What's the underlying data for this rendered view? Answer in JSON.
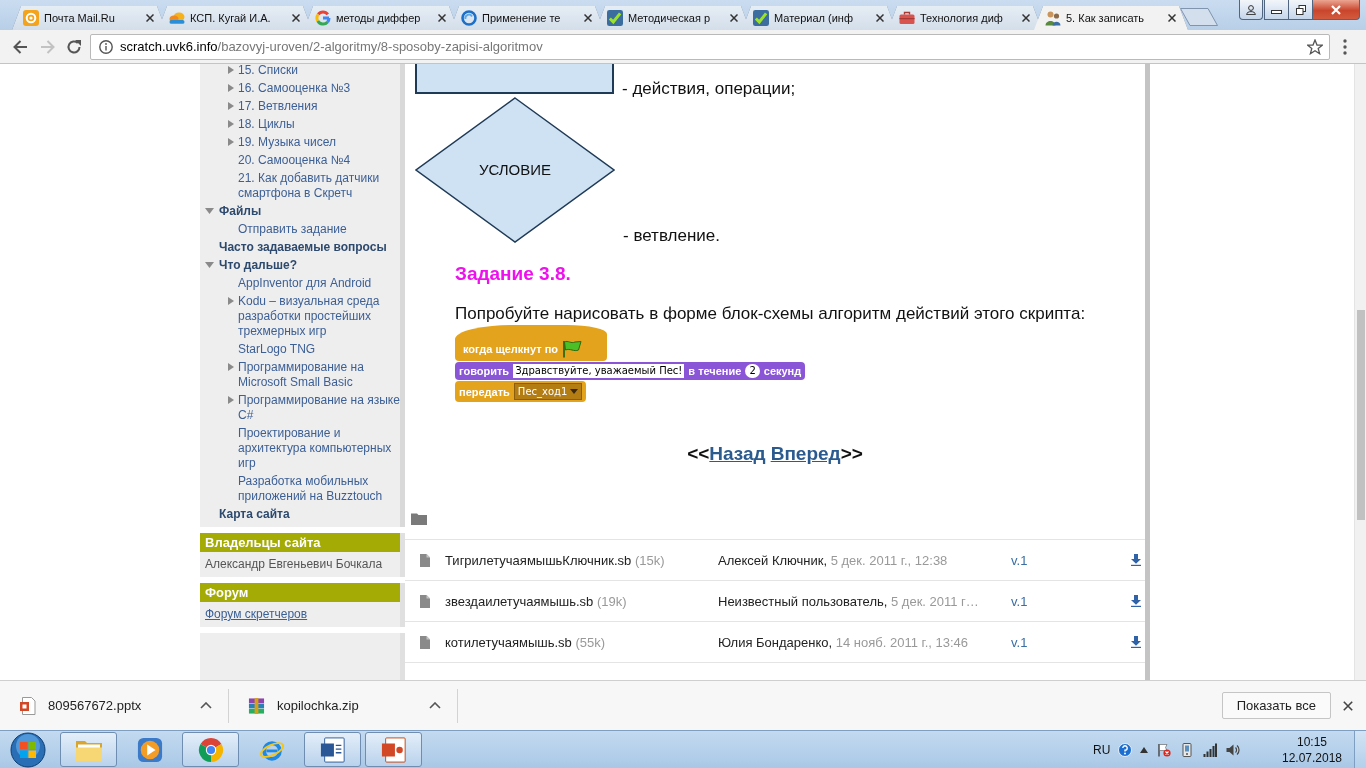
{
  "browser": {
    "tabs": [
      {
        "title": "Почта Mail.Ru",
        "selected": false
      },
      {
        "title": "КСП. Кугай И.А.",
        "selected": false
      },
      {
        "title": "методы диффер",
        "selected": false
      },
      {
        "title": "Применение те",
        "selected": false
      },
      {
        "title": "Методическая р",
        "selected": false
      },
      {
        "title": "Материал (инф",
        "selected": false
      },
      {
        "title": "Технология диф",
        "selected": false
      },
      {
        "title": "5. Как записать",
        "selected": true
      }
    ],
    "can_go_back": true,
    "can_go_forward": false,
    "address": {
      "host": "scratch.uvk6.info",
      "path": "/bazovyj-uroven/2-algoritmy/8-sposoby-zapisi-algoritmov"
    }
  },
  "sidebar": {
    "nav": [
      {
        "children": [
          {
            "label": "15. Списки",
            "expanded": false
          },
          {
            "label": "16. Самооценка №3",
            "expanded": false
          },
          {
            "label": "17. Ветвления",
            "expanded": false
          },
          {
            "label": "18. Циклы",
            "expanded": false
          },
          {
            "label": "19. Музыка чисел",
            "expanded": false
          },
          {
            "label": "20. Самооценка №4"
          },
          {
            "label": "21. Как добавить датчики смартфона в Скретч"
          }
        ]
      },
      {
        "label": "Файлы",
        "expanded": true,
        "children": [
          {
            "label": "Отправить задание"
          }
        ]
      },
      {
        "label": "Часто задаваемые вопросы"
      },
      {
        "label": "Что дальше?",
        "expanded": true,
        "children": [
          {
            "label": "AppInventor для Android"
          },
          {
            "label": "Kodu – визуальная среда разработки простейших трехмерных игр",
            "expanded": false
          },
          {
            "label": "StarLogo TNG"
          },
          {
            "label": "Программирование на Microsoft Small Basic",
            "expanded": false
          },
          {
            "label": "Программирование на языке C#",
            "expanded": false
          },
          {
            "label": "Проектирование и архитектура компьютерных игр"
          },
          {
            "label": "Разработка мобильных приложений на Buzztouch"
          }
        ]
      },
      {
        "label": "Карта сайта"
      }
    ],
    "panels": [
      {
        "title": "Владельцы сайта",
        "kind": "text",
        "text": "Александр Евгеньевич Бочкала"
      },
      {
        "title": "Форум",
        "kind": "link",
        "text": "Форум скретчеров"
      }
    ]
  },
  "content": {
    "legend": [
      {
        "kind": "process",
        "caption": "- действия, операции;"
      },
      {
        "kind": "decision",
        "label": "УСЛОВИЕ",
        "caption": "- ветвление."
      }
    ],
    "task": {
      "title": "Задание 3.8.",
      "text": "Попробуйте нарисовать в форме блок-схемы алгоритм действий этого скрипта:"
    },
    "script": [
      {
        "kind": "hat",
        "color": "#e3a31d",
        "parts": [
          {
            "kind": "text",
            "text": "когда щелкнут по"
          },
          {
            "kind": "flag"
          }
        ]
      },
      {
        "kind": "stack",
        "color": "#8a55d7",
        "parts": [
          {
            "kind": "text",
            "text": "говорить"
          },
          {
            "kind": "input",
            "text": "Здравствуйте, уважаемый Пес!"
          },
          {
            "kind": "text",
            "text": "в течение"
          },
          {
            "kind": "number",
            "text": "2"
          },
          {
            "kind": "text",
            "text": "секунд"
          }
        ]
      },
      {
        "kind": "stack",
        "color": "#e3a31d",
        "parts": [
          {
            "kind": "text",
            "text": "передать"
          },
          {
            "kind": "dropdown",
            "text": "Пес_ход1"
          }
        ]
      }
    ],
    "pager": {
      "prev_mark": "<<",
      "back": "Назад",
      "forward": "Вперед",
      "next_mark": ">>"
    }
  },
  "files": {
    "rows": [
      {
        "name": "ТигрилетучаямышьКлючник.sb",
        "size": "(15k)",
        "author": "Алексей Ключник,",
        "date": "5 дек. 2011 г., 12:38",
        "version": "v.1"
      },
      {
        "name": "звездаилетучаямышь.sb",
        "size": "(19k)",
        "author": "Неизвестный пользователь,",
        "date": "5 дек. 2011 г…",
        "version": "v.1"
      },
      {
        "name": "котилетучаямышь.sb",
        "size": "(55k)",
        "author": "Юлия Бондаренко,",
        "date": "14 нояб. 2011 г., 13:46",
        "version": "v.1"
      }
    ]
  },
  "downloads": {
    "items": [
      {
        "name": "809567672.pptx"
      },
      {
        "name": "kopilochka.zip"
      }
    ],
    "show_all": "Показать все"
  },
  "taskbar": {
    "apps": [
      {
        "running": true
      },
      {
        "running": false
      },
      {
        "running": true
      },
      {
        "running": false
      },
      {
        "running": true
      },
      {
        "running": true
      }
    ],
    "language": "RU",
    "time": "10:15",
    "date": "12.07.2018"
  }
}
